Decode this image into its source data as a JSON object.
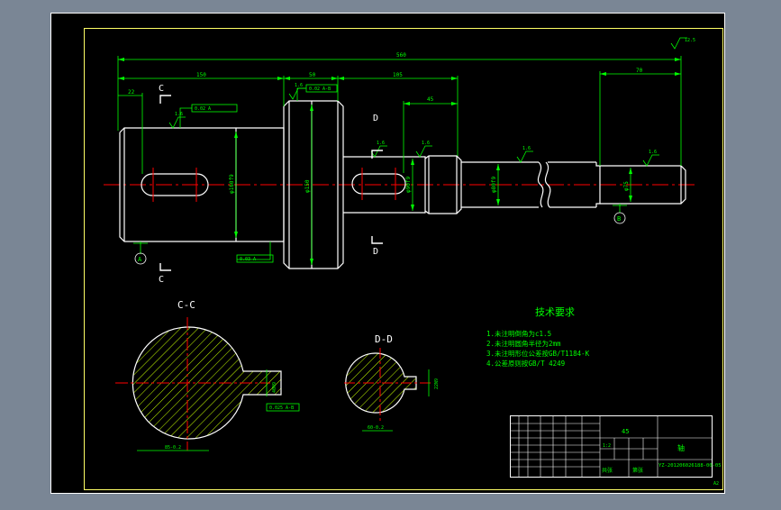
{
  "colors": {
    "background": "#7a8695",
    "paper": "#000000",
    "outline": "#ffffff",
    "dimension": "#00ff00",
    "centerline": "#ff0000",
    "hatch": "#c8ff00",
    "frame": "#ffff66"
  },
  "drawing": {
    "dims": {
      "overall": "560",
      "left_len": "150",
      "collar_len": "50",
      "mid_len": "105",
      "key_d_len": "45",
      "right_len": "70",
      "small": "22"
    },
    "diameters": {
      "d1": "φ160f9",
      "d2": "φ150",
      "d3": "φ90f9",
      "d4": "φ80f9",
      "d5": "φ75"
    },
    "roughness": [
      "1.6",
      "1.6",
      "1.6",
      "1.6",
      "1.6",
      "1.6"
    ],
    "roughness_other": "12.5",
    "tolerance_frames": [
      "0.02 A",
      "0.02 A-B",
      "0.03 A",
      "0.025 A-B"
    ],
    "datums": [
      "A",
      "B"
    ],
    "section_labels": {
      "c_top": "C",
      "c_bottom": "C",
      "d_top": "D",
      "d_bottom": "D",
      "cc_title": "C-C",
      "dd_title": "D-D"
    },
    "section_dims": {
      "cc_width": "40N9",
      "cc_depth": "85-0.2",
      "dd_width": "22N9",
      "dd_depth": "60-0.2"
    },
    "tech_title": "技术要求",
    "tech_requirements": [
      "1.未注明倒角为c1.5",
      "2.未注明圆角半径为2mm",
      "3.未注明形位公差按GB/T1184-K",
      "4.公差原则按GB/T 4249"
    ]
  },
  "title_block": {
    "material": "45",
    "drawing_no": "YZ-201206026188-00-05",
    "part_name": "轴",
    "scale": "1:2",
    "sheet_count": "共张",
    "sheet_no": "第张"
  },
  "page_no": "A2"
}
